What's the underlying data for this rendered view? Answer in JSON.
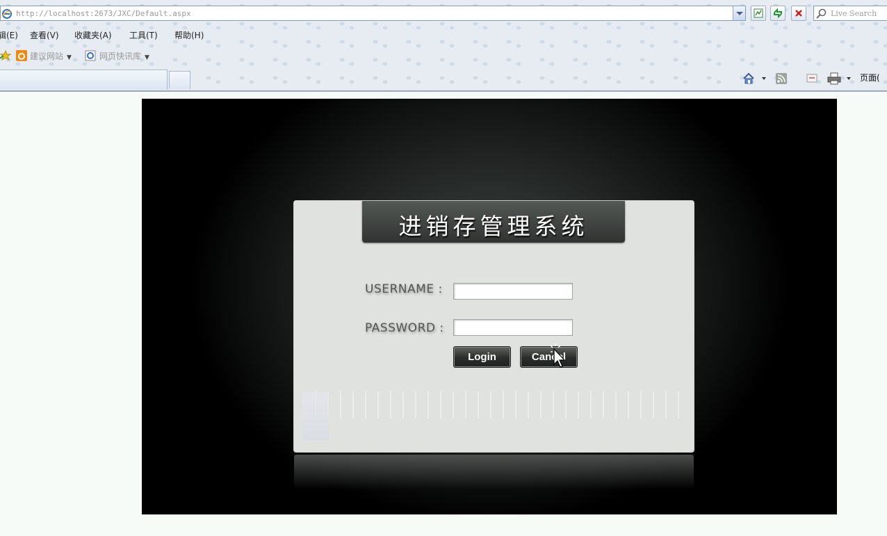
{
  "browser": {
    "address_url": "http://localhost:2673/JXC/Default.aspx",
    "search_placeholder": "Live Search",
    "menu": [
      "编辑(E)",
      "查看(V)",
      "收藏夹(A)",
      "工具(T)",
      "帮助(H)"
    ],
    "menu_visible": [
      "辑(E)",
      "查看(V)",
      "收藏夹(A)",
      "工具(T)",
      "帮助(H)"
    ],
    "favorites": [
      "建议网站",
      "网页快讯库"
    ],
    "page_menu_label": "页面(",
    "icons": [
      "ie-page-icon",
      "compatibility-icon",
      "refresh-icon",
      "stop-icon",
      "search-icon",
      "favorites-star-icon",
      "home-icon",
      "rss-feed-icon",
      "read-mail-icon",
      "print-icon"
    ]
  },
  "login": {
    "title": "进销存管理系统",
    "username_label": "USERNAME :",
    "password_label": "PASSWORD :",
    "username_value": "",
    "password_value": "",
    "login_label": "Login",
    "cancel_label": "Cancel"
  },
  "colors": {
    "stage_bg": "#000000",
    "panel_bg": "#dfe2de",
    "title_bar": "#3c3f3d",
    "button": "#2a2d2b"
  }
}
